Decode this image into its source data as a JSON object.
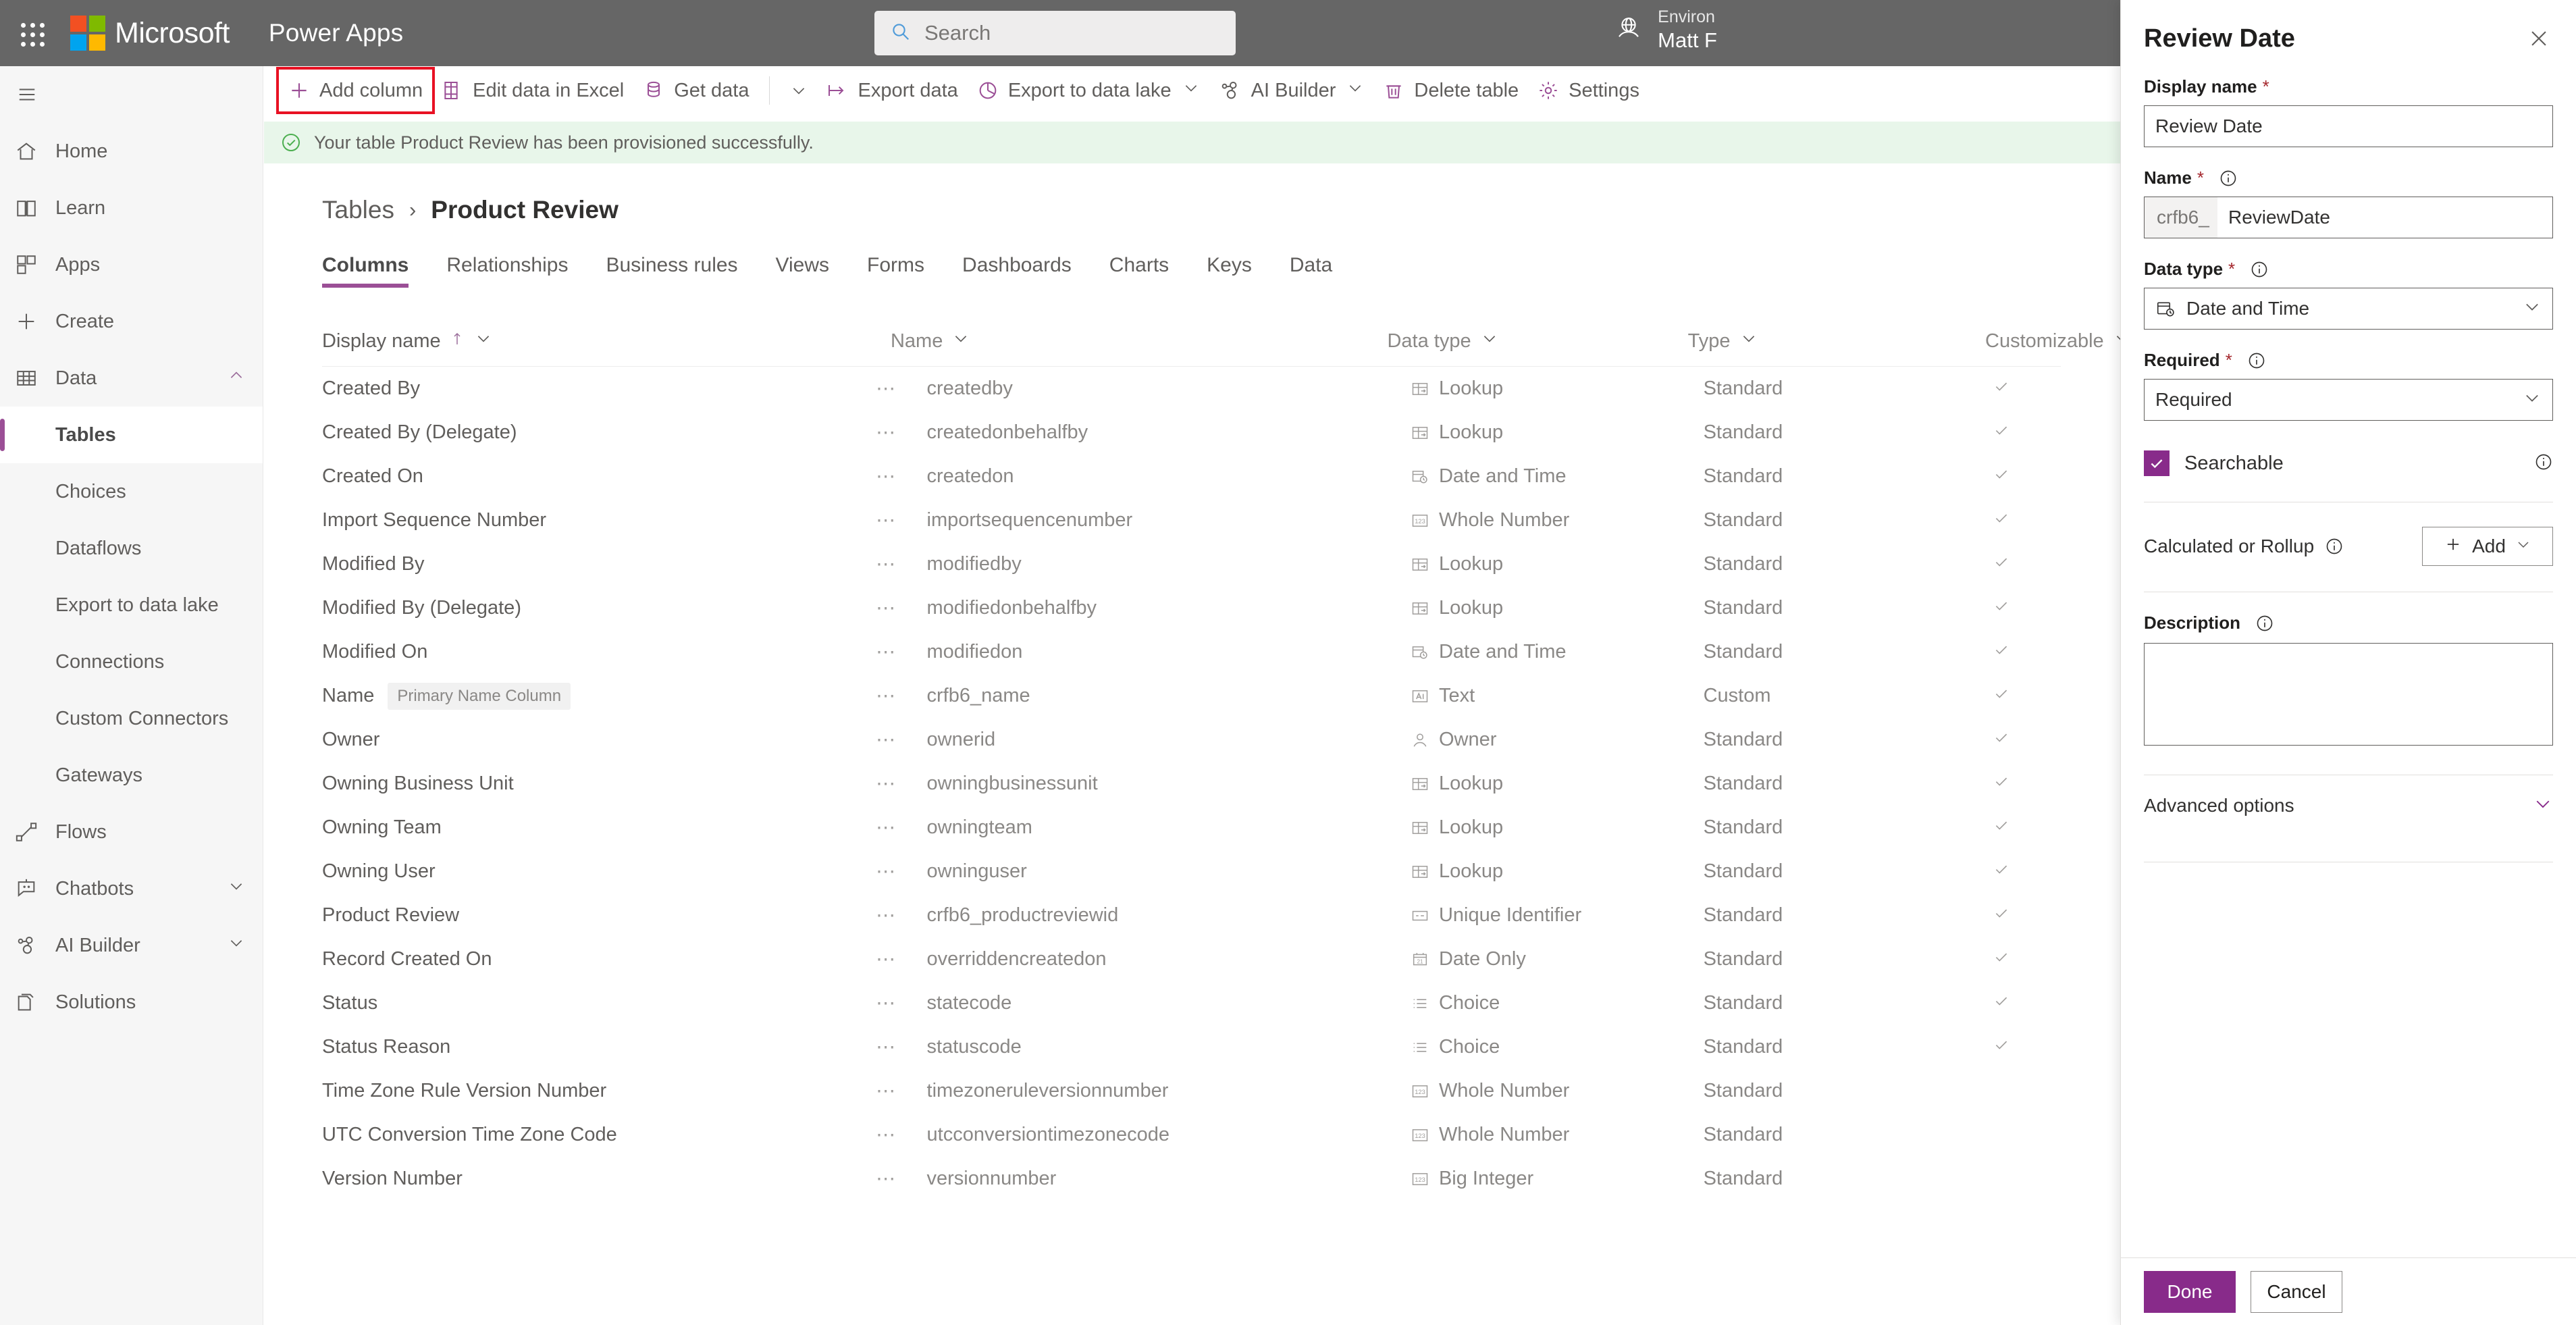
{
  "suite": {
    "brand": "Microsoft",
    "app_name": "Power Apps",
    "waffle_icon": "waffle-icon",
    "brand_colors": [
      "#f25022",
      "#7fba00",
      "#00a4ef",
      "#ffb900"
    ],
    "search": {
      "placeholder": "Search",
      "value": "",
      "icon": "search-icon"
    },
    "environment": {
      "label": "Environ",
      "value": "Matt F",
      "icon": "globe-icon"
    }
  },
  "sidebar": {
    "hamburger_icon": "hamburger-icon",
    "items": [
      {
        "label": "Home",
        "icon": "home-icon",
        "level": 0,
        "chevron": "",
        "active": false
      },
      {
        "label": "Learn",
        "icon": "book-icon",
        "level": 0,
        "chevron": "",
        "active": false
      },
      {
        "label": "Apps",
        "icon": "apps-grid-icon",
        "level": 0,
        "chevron": "",
        "active": false
      },
      {
        "label": "Create",
        "icon": "plus-icon",
        "level": 0,
        "chevron": "",
        "active": false
      },
      {
        "label": "Data",
        "icon": "table-icon",
        "level": 0,
        "chevron": "chevron-up-icon",
        "active": false
      },
      {
        "label": "Tables",
        "icon": "",
        "level": 1,
        "chevron": "",
        "active": true
      },
      {
        "label": "Choices",
        "icon": "",
        "level": 1,
        "chevron": "",
        "active": false
      },
      {
        "label": "Dataflows",
        "icon": "",
        "level": 1,
        "chevron": "",
        "active": false
      },
      {
        "label": "Export to data lake",
        "icon": "",
        "level": 1,
        "chevron": "",
        "active": false
      },
      {
        "label": "Connections",
        "icon": "",
        "level": 1,
        "chevron": "",
        "active": false
      },
      {
        "label": "Custom Connectors",
        "icon": "",
        "level": 1,
        "chevron": "",
        "active": false
      },
      {
        "label": "Gateways",
        "icon": "",
        "level": 1,
        "chevron": "",
        "active": false
      },
      {
        "label": "Flows",
        "icon": "flow-icon",
        "level": 0,
        "chevron": "",
        "active": false
      },
      {
        "label": "Chatbots",
        "icon": "chatbot-icon",
        "level": 0,
        "chevron": "chevron-down-icon",
        "active": false
      },
      {
        "label": "AI Builder",
        "icon": "ai-builder-icon",
        "level": 0,
        "chevron": "chevron-down-icon",
        "active": false
      },
      {
        "label": "Solutions",
        "icon": "solutions-icon",
        "level": 0,
        "chevron": "",
        "active": false
      }
    ]
  },
  "command_bar": {
    "items": [
      {
        "label": "Add column",
        "icon": "plus-icon",
        "caret": false,
        "highlighted": true
      },
      {
        "label": "Edit data in Excel",
        "icon": "excel-icon",
        "caret": false,
        "highlighted": false
      },
      {
        "label": "Get data",
        "icon": "get-data-icon",
        "caret": false,
        "highlighted": false
      },
      {
        "label": "",
        "icon": "chevron-down-icon",
        "caret": false,
        "highlighted": false,
        "separator_before": true,
        "caret_only": true
      },
      {
        "label": "Export data",
        "icon": "export-data-icon",
        "caret": false,
        "highlighted": false
      },
      {
        "label": "Export to data lake",
        "icon": "data-lake-icon",
        "caret": true,
        "highlighted": false
      },
      {
        "label": "AI Builder",
        "icon": "ai-builder-icon",
        "caret": true,
        "highlighted": false
      },
      {
        "label": "Delete table",
        "icon": "trash-icon",
        "caret": false,
        "highlighted": false
      },
      {
        "label": "Settings",
        "icon": "gear-icon",
        "caret": false,
        "highlighted": false
      }
    ]
  },
  "banner": {
    "icon": "success-check-icon",
    "message": "Your table Product Review has been provisioned successfully."
  },
  "breadcrumb": {
    "parent": "Tables",
    "separator": "›",
    "current": "Product Review"
  },
  "tabs": [
    {
      "label": "Columns",
      "active": true
    },
    {
      "label": "Relationships",
      "active": false
    },
    {
      "label": "Business rules",
      "active": false
    },
    {
      "label": "Views",
      "active": false
    },
    {
      "label": "Forms",
      "active": false
    },
    {
      "label": "Dashboards",
      "active": false
    },
    {
      "label": "Charts",
      "active": false
    },
    {
      "label": "Keys",
      "active": false
    },
    {
      "label": "Data",
      "active": false
    }
  ],
  "table": {
    "columns": [
      {
        "header": "Display name",
        "sort": "ascending",
        "sort_icon": "arrow-up-icon",
        "caret": "chevron-down-icon"
      },
      {
        "header": "Name",
        "sort": "",
        "sort_icon": "",
        "caret": "chevron-down-icon"
      },
      {
        "header": "Data type",
        "sort": "",
        "sort_icon": "",
        "caret": "chevron-down-icon"
      },
      {
        "header": "Type",
        "sort": "",
        "sort_icon": "",
        "caret": "chevron-down-icon"
      },
      {
        "header": "Customizable",
        "sort": "",
        "sort_icon": "",
        "caret": "chevron-down-icon"
      }
    ],
    "overflow_glyph": "⋯",
    "rows": [
      {
        "display_name": "Created By",
        "badge": "",
        "name": "createdby",
        "data_type": "Lookup",
        "dt_icon": "lookup-icon",
        "type": "Standard",
        "customizable": true
      },
      {
        "display_name": "Created By (Delegate)",
        "badge": "",
        "name": "createdonbehalfby",
        "data_type": "Lookup",
        "dt_icon": "lookup-icon",
        "type": "Standard",
        "customizable": true
      },
      {
        "display_name": "Created On",
        "badge": "",
        "name": "createdon",
        "data_type": "Date and Time",
        "dt_icon": "datetime-icon",
        "type": "Standard",
        "customizable": true
      },
      {
        "display_name": "Import Sequence Number",
        "badge": "",
        "name": "importsequencenumber",
        "data_type": "Whole Number",
        "dt_icon": "number-icon",
        "type": "Standard",
        "customizable": true
      },
      {
        "display_name": "Modified By",
        "badge": "",
        "name": "modifiedby",
        "data_type": "Lookup",
        "dt_icon": "lookup-icon",
        "type": "Standard",
        "customizable": true
      },
      {
        "display_name": "Modified By (Delegate)",
        "badge": "",
        "name": "modifiedonbehalfby",
        "data_type": "Lookup",
        "dt_icon": "lookup-icon",
        "type": "Standard",
        "customizable": true
      },
      {
        "display_name": "Modified On",
        "badge": "",
        "name": "modifiedon",
        "data_type": "Date and Time",
        "dt_icon": "datetime-icon",
        "type": "Standard",
        "customizable": true
      },
      {
        "display_name": "Name",
        "badge": "Primary Name Column",
        "name": "crfb6_name",
        "data_type": "Text",
        "dt_icon": "text-icon",
        "type": "Custom",
        "customizable": true
      },
      {
        "display_name": "Owner",
        "badge": "",
        "name": "ownerid",
        "data_type": "Owner",
        "dt_icon": "owner-icon",
        "type": "Standard",
        "customizable": true
      },
      {
        "display_name": "Owning Business Unit",
        "badge": "",
        "name": "owningbusinessunit",
        "data_type": "Lookup",
        "dt_icon": "lookup-icon",
        "type": "Standard",
        "customizable": true
      },
      {
        "display_name": "Owning Team",
        "badge": "",
        "name": "owningteam",
        "data_type": "Lookup",
        "dt_icon": "lookup-icon",
        "type": "Standard",
        "customizable": true
      },
      {
        "display_name": "Owning User",
        "badge": "",
        "name": "owninguser",
        "data_type": "Lookup",
        "dt_icon": "lookup-icon",
        "type": "Standard",
        "customizable": true
      },
      {
        "display_name": "Product Review",
        "badge": "",
        "name": "crfb6_productreviewid",
        "data_type": "Unique Identifier",
        "dt_icon": "guid-icon",
        "type": "Standard",
        "customizable": true
      },
      {
        "display_name": "Record Created On",
        "badge": "",
        "name": "overriddencreatedon",
        "data_type": "Date Only",
        "dt_icon": "dateonly-icon",
        "type": "Standard",
        "customizable": true
      },
      {
        "display_name": "Status",
        "badge": "",
        "name": "statecode",
        "data_type": "Choice",
        "dt_icon": "choice-icon",
        "type": "Standard",
        "customizable": true
      },
      {
        "display_name": "Status Reason",
        "badge": "",
        "name": "statuscode",
        "data_type": "Choice",
        "dt_icon": "choice-icon",
        "type": "Standard",
        "customizable": true
      },
      {
        "display_name": "Time Zone Rule Version Number",
        "badge": "",
        "name": "timezoneruleversionnumber",
        "data_type": "Whole Number",
        "dt_icon": "number-icon",
        "type": "Standard",
        "customizable": false
      },
      {
        "display_name": "UTC Conversion Time Zone Code",
        "badge": "",
        "name": "utcconversiontimezonecode",
        "data_type": "Whole Number",
        "dt_icon": "number-icon",
        "type": "Standard",
        "customizable": false
      },
      {
        "display_name": "Version Number",
        "badge": "",
        "name": "versionnumber",
        "data_type": "Big Integer",
        "dt_icon": "number-icon",
        "type": "Standard",
        "customizable": false
      }
    ]
  },
  "panel": {
    "title": "Review Date",
    "close_icon": "close-icon",
    "display_name": {
      "label": "Display name",
      "required": "*",
      "value": "Review Date",
      "placeholder": ""
    },
    "name": {
      "label": "Name",
      "required": "*",
      "info_icon": "info-icon",
      "prefix": "crfb6_",
      "value": "ReviewDate"
    },
    "data_type": {
      "label": "Data type",
      "required": "*",
      "info_icon": "info-icon",
      "value": "Date and Time",
      "icon": "datetime-icon",
      "caret": "chevron-down-icon"
    },
    "required_field": {
      "label": "Required",
      "required": "*",
      "info_icon": "info-icon",
      "value": "Required",
      "caret": "chevron-down-icon"
    },
    "searchable": {
      "label": "Searchable",
      "checked": true,
      "info_icon": "info-icon",
      "check_glyph": "✓",
      "accent": "#882b8a"
    },
    "calculated_or_rollup": {
      "label": "Calculated or Rollup",
      "info_icon": "info-icon",
      "add_label": "Add",
      "add_icon": "plus-icon",
      "add_caret": "chevron-down-icon"
    },
    "description": {
      "label": "Description",
      "info_icon": "info-icon",
      "value": "",
      "placeholder": ""
    },
    "advanced_options": {
      "label": "Advanced options",
      "caret": "chevron-down-icon"
    },
    "footer": {
      "primary": "Done",
      "secondary": "Cancel"
    }
  }
}
